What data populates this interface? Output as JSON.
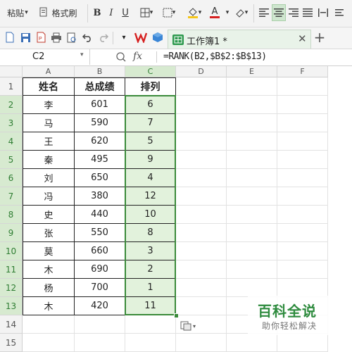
{
  "ribbon": {
    "paste_label": "粘贴",
    "format_painter_label": "格式刷",
    "bold": "B",
    "italic": "I",
    "underline": "U",
    "font_color_glyph": "A"
  },
  "document": {
    "tab_title": "工作簿1 *"
  },
  "formula_bar": {
    "cell_ref": "C2",
    "fx": "fx",
    "formula": "=RANK(B2,$B$2:$B$13)"
  },
  "sheet": {
    "columns": [
      "A",
      "B",
      "C",
      "D",
      "E",
      "F"
    ],
    "rows": [
      "1",
      "2",
      "3",
      "4",
      "5",
      "6",
      "7",
      "8",
      "9",
      "10",
      "11",
      "12",
      "13",
      "14",
      "15"
    ],
    "headers": [
      "姓名",
      "总成绩",
      "排列"
    ],
    "data": [
      [
        "李",
        "601",
        "6"
      ],
      [
        "马",
        "590",
        "7"
      ],
      [
        "王",
        "620",
        "5"
      ],
      [
        "秦",
        "495",
        "9"
      ],
      [
        "刘",
        "650",
        "4"
      ],
      [
        "冯",
        "380",
        "12"
      ],
      [
        "史",
        "440",
        "10"
      ],
      [
        "张",
        "550",
        "8"
      ],
      [
        "莫",
        "660",
        "3"
      ],
      [
        "木",
        "690",
        "2"
      ],
      [
        "杨",
        "700",
        "1"
      ],
      [
        "木",
        "420",
        "11"
      ]
    ],
    "selected_column": "C",
    "accent_color": "#3a8a3a"
  },
  "watermark": {
    "title": "百科全说",
    "subtitle": "助你轻松解决"
  }
}
